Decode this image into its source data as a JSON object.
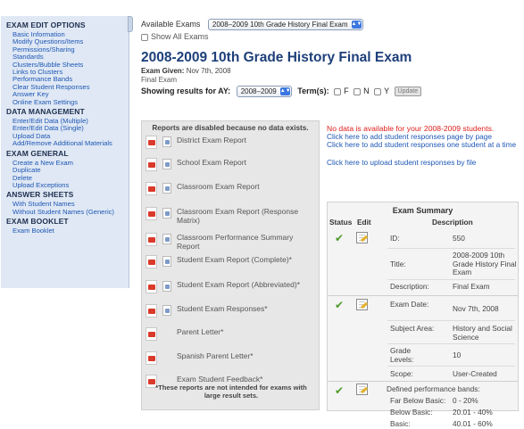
{
  "sidebar": {
    "sections": [
      {
        "heading": "EXAM EDIT OPTIONS",
        "items": [
          "Basic Information",
          "Modify Questions/Items",
          "Permissions/Sharing",
          "Standards",
          "Clusters/Bubble Sheets",
          "Links to Clusters",
          "Performance Bands",
          "Clear Student Responses",
          "Answer Key",
          "Online Exam Settings"
        ]
      },
      {
        "heading": "DATA MANAGEMENT",
        "items": [
          "Enter/Edit Data (Multiple)",
          "Enter/Edit Data (Single)",
          "Upload Data",
          "Add/Remove Additional Materials"
        ]
      },
      {
        "heading": "EXAM GENERAL",
        "items": [
          "Create a New Exam",
          "Duplicate",
          "Delete",
          "Upload Exceptions"
        ]
      },
      {
        "heading": "ANSWER SHEETS",
        "items": [
          "With Student Names",
          "Without Student Names (Generic)"
        ]
      },
      {
        "heading": "EXAM BOOKLET",
        "items": [
          "Exam Booklet"
        ]
      }
    ]
  },
  "top": {
    "available_label": "Available Exams",
    "exam_select": "2008–2009 10th Grade History Final Exam",
    "show_all": "Show All Exams",
    "title": "2008-2009 10th Grade History Final Exam",
    "exam_given_label": "Exam Given:",
    "exam_given_value": "Nov 7th, 2008",
    "subtitle": "Final Exam",
    "ay_label": "Showing results for AY:",
    "ay_value": "2008–2009",
    "term_label": "Term(s):",
    "terms": [
      "F",
      "N",
      "Y"
    ],
    "update": "Update"
  },
  "reports": {
    "note": "Reports are disabled because no data exists.",
    "items": [
      {
        "label": "District Exam Report",
        "doc": true
      },
      {
        "label": "School Exam Report",
        "doc": true
      },
      {
        "label": "Classroom Exam Report",
        "doc": true
      },
      {
        "label": "Classroom Exam Report (Response Matrix)",
        "doc": true
      },
      {
        "label": "Classroom Performance Summary Report",
        "doc": true
      },
      {
        "label": "Student Exam Report (Complete)*",
        "doc": true
      },
      {
        "label": "Student Exam Report (Abbreviated)*",
        "doc": true
      },
      {
        "label": "Student Exam Responses*",
        "doc": true
      },
      {
        "label": "Parent Letter*",
        "doc": false
      },
      {
        "label": "Spanish Parent Letter*",
        "doc": false
      },
      {
        "label": "Exam Student Feedback*",
        "doc": false
      }
    ],
    "footer": "*These reports are not intended for exams with large result sets."
  },
  "right": {
    "no_data": "No data is available for your 2008-2009 students.",
    "links": [
      "Click here to add student responses page by page",
      "Click here to add student responses one student at a time",
      "Click here to upload student responses by file"
    ],
    "summary": {
      "title": "Exam Summary",
      "headers": [
        "Status",
        "Edit",
        "Description"
      ],
      "id_label": "ID:",
      "id_value": "550",
      "title_label": "Title:",
      "title_value": "2008-2009 10th Grade History Final Exam",
      "desc_label": "Description:",
      "desc_value": "Final Exam",
      "date_label": "Exam Date:",
      "date_value": "Nov 7th, 2008",
      "subject_label": "Subject Area:",
      "subject_value": "History and Social Science",
      "grade_label": "Grade Levels:",
      "grade_value": "10",
      "scope_label": "Scope:",
      "scope_value": "User-Created",
      "bands_title": "Defined performance bands:",
      "bands": [
        {
          "name": "Far Below Basic:",
          "range": "0 - 20%"
        },
        {
          "name": "Below Basic:",
          "range": "20.01 - 40%"
        },
        {
          "name": "Basic:",
          "range": "40.01 - 60%"
        }
      ],
      "status_color": "#4d9a2a"
    }
  },
  "colors": {
    "link": "#1f57b5",
    "title": "#1e3f7a",
    "error": "#e02020",
    "sidebar_bg": "#dfe8f4"
  }
}
